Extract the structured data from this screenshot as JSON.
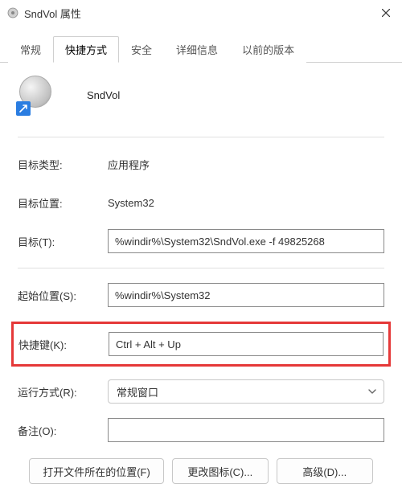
{
  "window": {
    "title": "SndVol 属性"
  },
  "tabs": {
    "general": "常规",
    "shortcut": "快捷方式",
    "security": "安全",
    "details": "详细信息",
    "previous": "以前的版本",
    "active": "shortcut"
  },
  "header": {
    "app_name": "SndVol"
  },
  "fields": {
    "target_type": {
      "label": "目标类型:",
      "value": "应用程序"
    },
    "target_loc": {
      "label": "目标位置:",
      "value": "System32"
    },
    "target": {
      "label": "目标(T):",
      "value": "%windir%\\System32\\SndVol.exe -f 49825268"
    },
    "start_in": {
      "label": "起始位置(S):",
      "value": "%windir%\\System32"
    },
    "shortcut_key": {
      "label": "快捷键(K):",
      "value": "Ctrl + Alt + Up"
    },
    "run": {
      "label": "运行方式(R):",
      "value": "常规窗口"
    },
    "comment": {
      "label": "备注(O):",
      "value": ""
    }
  },
  "buttons": {
    "open_location": "打开文件所在的位置(F)",
    "change_icon": "更改图标(C)...",
    "advanced": "高级(D)..."
  }
}
